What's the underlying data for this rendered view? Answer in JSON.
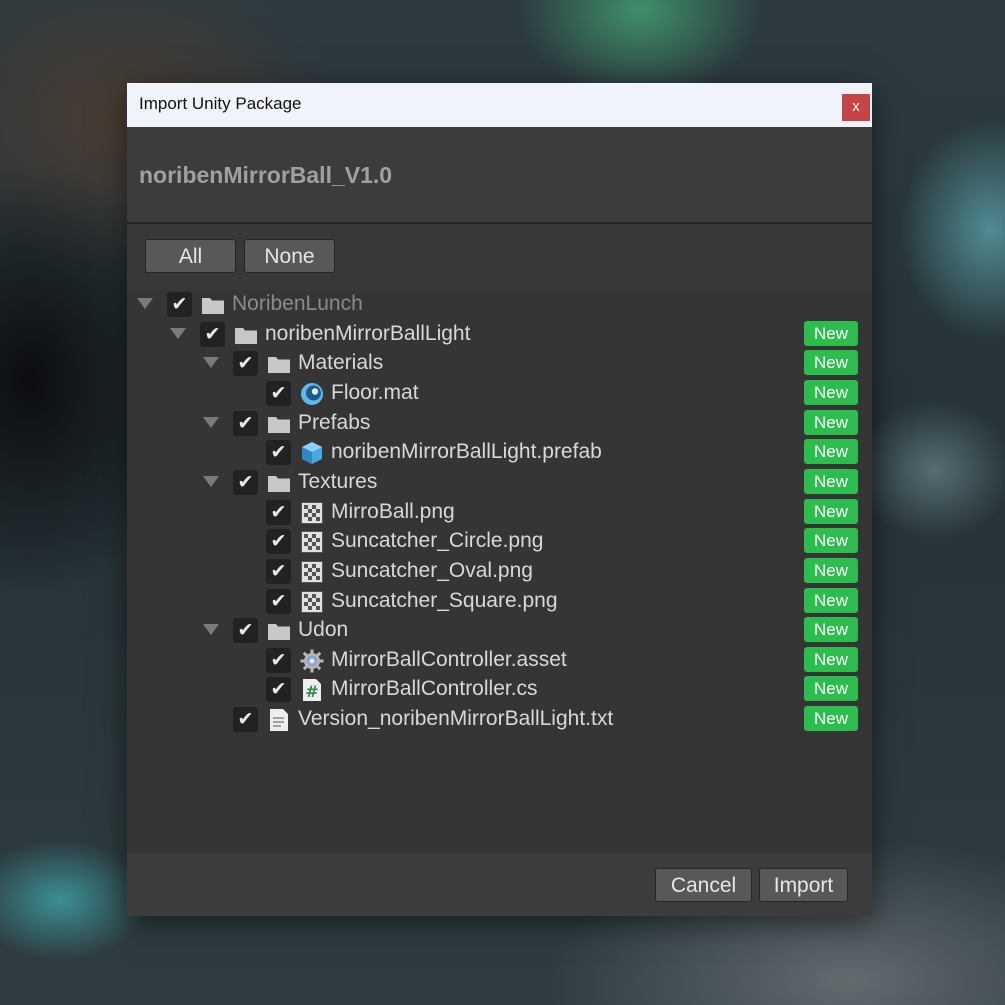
{
  "window": {
    "title": "Import Unity Package",
    "close_label": "x"
  },
  "package": {
    "name": "noribenMirrorBall_V1.0"
  },
  "selection_buttons": {
    "all": "All",
    "none": "None"
  },
  "badge_text": "New",
  "tree": [
    {
      "label": "NoribenLunch",
      "icon": "folder-icon",
      "expanded": true,
      "checked": true,
      "new": false,
      "depth": 0,
      "dim": true
    },
    {
      "label": "noribenMirrorBallLight",
      "icon": "folder-icon",
      "expanded": true,
      "checked": true,
      "new": true,
      "depth": 1
    },
    {
      "label": "Materials",
      "icon": "folder-icon",
      "expanded": true,
      "checked": true,
      "new": true,
      "depth": 2
    },
    {
      "label": "Floor.mat",
      "icon": "material-icon",
      "checked": true,
      "new": true,
      "depth": 3
    },
    {
      "label": "Prefabs",
      "icon": "folder-icon",
      "expanded": true,
      "checked": true,
      "new": true,
      "depth": 2
    },
    {
      "label": "noribenMirrorBallLight.prefab",
      "icon": "prefab-icon",
      "checked": true,
      "new": true,
      "depth": 3
    },
    {
      "label": "Textures",
      "icon": "folder-icon",
      "expanded": true,
      "checked": true,
      "new": true,
      "depth": 2
    },
    {
      "label": "MirroBall.png",
      "icon": "texture-icon",
      "checked": true,
      "new": true,
      "depth": 3
    },
    {
      "label": "Suncatcher_Circle.png",
      "icon": "texture-icon",
      "checked": true,
      "new": true,
      "depth": 3
    },
    {
      "label": "Suncatcher_Oval.png",
      "icon": "texture-icon",
      "checked": true,
      "new": true,
      "depth": 3
    },
    {
      "label": "Suncatcher_Square.png",
      "icon": "texture-icon",
      "checked": true,
      "new": true,
      "depth": 3
    },
    {
      "label": "Udon",
      "icon": "folder-icon",
      "expanded": true,
      "checked": true,
      "new": true,
      "depth": 2
    },
    {
      "label": "MirrorBallController.asset",
      "icon": "gear-asset-icon",
      "checked": true,
      "new": true,
      "depth": 3
    },
    {
      "label": "MirrorBallController.cs",
      "icon": "csharp-script-icon",
      "checked": true,
      "new": true,
      "depth": 3
    },
    {
      "label": "Version_noribenMirrorBallLight.txt",
      "icon": "text-file-icon",
      "checked": true,
      "new": true,
      "depth": 2
    }
  ],
  "footer": {
    "cancel": "Cancel",
    "import": "Import"
  },
  "colors": {
    "badge": "#2dbd4e",
    "close": "#c54445",
    "panel": "#383838",
    "titlebar": "#f0f3f9"
  }
}
